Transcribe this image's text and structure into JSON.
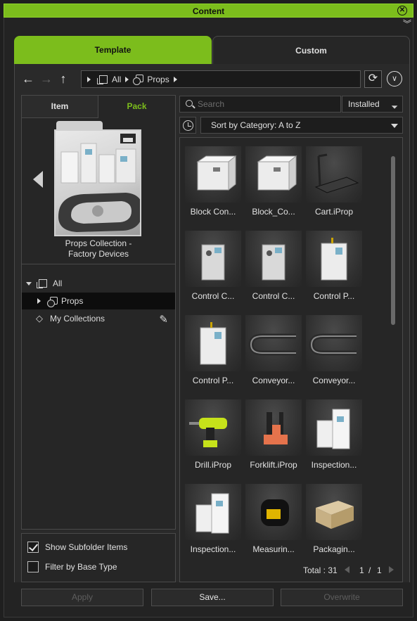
{
  "window": {
    "title": "Content"
  },
  "tabs": {
    "template": "Template",
    "custom": "Custom"
  },
  "breadcrumb": {
    "all": "All",
    "props": "Props"
  },
  "subtabs": {
    "item": "Item",
    "pack": "Pack"
  },
  "pack": {
    "name_line1": "Props Collection -",
    "name_line2": "Factory Devices"
  },
  "tree": {
    "all": "All",
    "props": "Props",
    "my_collections": "My Collections"
  },
  "options": {
    "show_subfolder": "Show Subfolder Items",
    "show_subfolder_checked": true,
    "filter_base": "Filter by Base Type",
    "filter_base_checked": false
  },
  "search": {
    "placeholder": "Search",
    "installed_label": "Installed"
  },
  "sort": {
    "label": "Sort by Category: A to Z"
  },
  "items": [
    {
      "label": "Block Con...",
      "icon": "block-container-thumb"
    },
    {
      "label": "Block_Co...",
      "icon": "block-container-thumb"
    },
    {
      "label": "Cart.iProp",
      "icon": "cart-thumb"
    },
    {
      "label": "Control C...",
      "icon": "control-cabinet-thumb"
    },
    {
      "label": "Control C...",
      "icon": "control-cabinet-thumb"
    },
    {
      "label": "Control P...",
      "icon": "control-panel-thumb"
    },
    {
      "label": "Control P...",
      "icon": "control-panel-thumb"
    },
    {
      "label": "Conveyor...",
      "icon": "conveyor-thumb"
    },
    {
      "label": "Conveyor...",
      "icon": "conveyor-thumb"
    },
    {
      "label": "Drill.iProp",
      "icon": "drill-thumb"
    },
    {
      "label": "Forklift.iProp",
      "icon": "forklift-thumb"
    },
    {
      "label": "Inspection...",
      "icon": "inspection-thumb"
    },
    {
      "label": "Inspection...",
      "icon": "inspection-thumb"
    },
    {
      "label": "Measurin...",
      "icon": "tape-measure-thumb"
    },
    {
      "label": "Packagin...",
      "icon": "package-box-thumb"
    }
  ],
  "pager": {
    "total_label": "Total : 31",
    "page": "1",
    "separator": "/",
    "page_count": "1"
  },
  "buttons": {
    "apply": "Apply",
    "save": "Save...",
    "overwrite": "Overwrite"
  },
  "colors": {
    "accent": "#7cbd1c",
    "background": "#232323"
  }
}
